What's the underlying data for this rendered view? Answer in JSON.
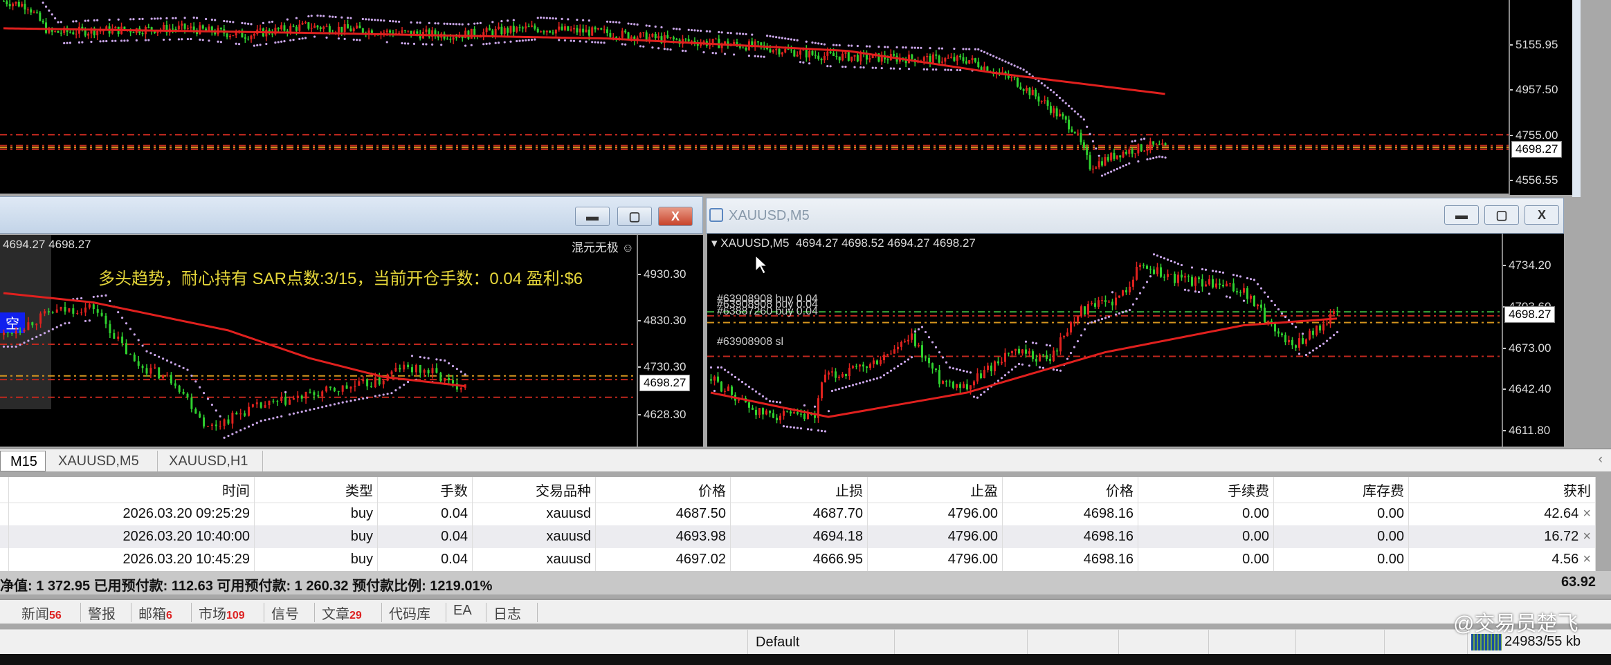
{
  "top_chart": {
    "axis": [
      "5155.95",
      "4957.50",
      "4755.00",
      "4556.55"
    ],
    "axis_prices": [
      5155.95,
      4957.5,
      4755.0,
      4556.55
    ],
    "price_min": 4500,
    "price_max": 5355,
    "current_price": "4698.27",
    "current": 4698.27,
    "path": [
      [
        0,
        5350
      ],
      [
        8,
        5330
      ],
      [
        15,
        5210
      ],
      [
        30,
        5220
      ],
      [
        60,
        5230
      ],
      [
        80,
        5200
      ],
      [
        100,
        5240
      ],
      [
        130,
        5210
      ],
      [
        150,
        5200
      ],
      [
        175,
        5230
      ],
      [
        200,
        5210
      ],
      [
        220,
        5180
      ],
      [
        250,
        5150
      ],
      [
        270,
        5110
      ],
      [
        290,
        5100
      ],
      [
        320,
        5090
      ],
      [
        335,
        5000
      ],
      [
        345,
        4900
      ],
      [
        355,
        4780
      ],
      [
        360,
        4620
      ],
      [
        370,
        4680
      ],
      [
        380,
        4710
      ],
      [
        385,
        4700
      ]
    ],
    "ma": [
      [
        0,
        5230
      ],
      [
        100,
        5210
      ],
      [
        200,
        5185
      ],
      [
        280,
        5130
      ],
      [
        330,
        5030
      ],
      [
        385,
        4940
      ]
    ],
    "lines": [
      {
        "price": 4760,
        "color": "#c0281e"
      },
      {
        "price": 4712,
        "color": "#c0281e"
      },
      {
        "price": 4704,
        "color": "#d4951e"
      },
      {
        "price": 4696,
        "color": "#c0281e"
      }
    ]
  },
  "left_window": {
    "ohlc": "4694.27 4698.27",
    "brand": "混元无极",
    "brand_icon": "smiley-icon",
    "signal_text": "多头趋势，耐心持有 SAR点数:3/15，当前开仓手数：0.04 盈利:$6",
    "badge": "空",
    "axis": [
      "4930.30",
      "4830.30",
      "4730.30",
      "4628.30"
    ],
    "axis_prices": [
      4930.3,
      4830.3,
      4730.3,
      4628.3
    ],
    "price_min": 4560,
    "price_max": 5015,
    "current_price": "4698.27",
    "current": 4698.27,
    "path": [
      [
        0,
        4800
      ],
      [
        12,
        4850
      ],
      [
        22,
        4860
      ],
      [
        32,
        4740
      ],
      [
        42,
        4700
      ],
      [
        50,
        4600
      ],
      [
        60,
        4640
      ],
      [
        80,
        4680
      ],
      [
        92,
        4700
      ],
      [
        97,
        4730
      ],
      [
        105,
        4720
      ],
      [
        110,
        4690
      ],
      [
        113,
        4698
      ]
    ],
    "ma": [
      [
        0,
        4890
      ],
      [
        22,
        4870
      ],
      [
        55,
        4810
      ],
      [
        75,
        4750
      ],
      [
        93,
        4710
      ],
      [
        113,
        4690
      ]
    ],
    "lines": [
      {
        "price": 4780,
        "color": "#c0281e"
      },
      {
        "price": 4712,
        "color": "#d4951e"
      },
      {
        "price": 4704,
        "color": "#c0281e"
      },
      {
        "price": 4666,
        "color": "#c0281e"
      }
    ]
  },
  "right_window": {
    "title": "XAUUSD,M5",
    "ohlc_label": "XAUUSD,M5  4694.27 4698.52 4694.27 4698.27",
    "axis": [
      "4734.20",
      "4703.60",
      "4673.00",
      "4642.40",
      "4611.80"
    ],
    "axis_prices": [
      4734.2,
      4703.6,
      4673.0,
      4642.4,
      4611.8
    ],
    "price_min": 4600,
    "price_max": 4758,
    "current_price": "4698.27",
    "current": 4698.27,
    "path": [
      [
        0,
        4650
      ],
      [
        14,
        4625
      ],
      [
        30,
        4620
      ],
      [
        32,
        4650
      ],
      [
        46,
        4660
      ],
      [
        58,
        4680
      ],
      [
        66,
        4650
      ],
      [
        74,
        4645
      ],
      [
        86,
        4670
      ],
      [
        98,
        4665
      ],
      [
        106,
        4700
      ],
      [
        118,
        4710
      ],
      [
        124,
        4735
      ],
      [
        134,
        4725
      ],
      [
        146,
        4720
      ],
      [
        154,
        4715
      ],
      [
        162,
        4690
      ],
      [
        168,
        4675
      ],
      [
        174,
        4685
      ],
      [
        181,
        4700
      ]
    ],
    "ma": [
      [
        0,
        4640
      ],
      [
        34,
        4622
      ],
      [
        74,
        4640
      ],
      [
        114,
        4670
      ],
      [
        154,
        4690
      ],
      [
        181,
        4695
      ]
    ],
    "lines": [
      {
        "price": 4700,
        "color": "#3aa93a"
      },
      {
        "price": 4697,
        "color": "#c0281e"
      },
      {
        "price": 4692,
        "color": "#d4951e"
      },
      {
        "price": 4666.95,
        "color": "#c0281e"
      }
    ],
    "order_labels": [
      "#63908908 buy 0.04",
      "#63887260 buy 0.04",
      "#63908908 sl"
    ]
  },
  "chart_tabs": [
    "M15",
    "XAUUSD,M5",
    "XAUUSD,H1"
  ],
  "trade_table": {
    "headers": [
      "时间",
      "类型",
      "手数",
      "交易品种",
      "价格",
      "止损",
      "止盈",
      "价格",
      "手续费",
      "库存费",
      "获利"
    ],
    "rows": [
      [
        "2026.03.20 09:25:29",
        "buy",
        "0.04",
        "xauusd",
        "4687.50",
        "4687.70",
        "4796.00",
        "4698.16",
        "0.00",
        "0.00",
        "42.64"
      ],
      [
        "2026.03.20 10:40:00",
        "buy",
        "0.04",
        "xauusd",
        "4693.98",
        "4694.18",
        "4796.00",
        "4698.16",
        "0.00",
        "0.00",
        "16.72"
      ],
      [
        "2026.03.20 10:45:29",
        "buy",
        "0.04",
        "xauusd",
        "4697.02",
        "4666.95",
        "4796.00",
        "4698.16",
        "0.00",
        "0.00",
        "4.56"
      ]
    ],
    "summary": "净值: 1 372.95  已用预付款: 112.63  可用预付款: 1 260.32  预付款比例: 1219.01%",
    "total_profit": "63.92"
  },
  "bottom_tabs": [
    {
      "label": "新闻",
      "count": "56"
    },
    {
      "label": "警报"
    },
    {
      "label": "邮箱",
      "count": "6"
    },
    {
      "label": "市场",
      "count": "109"
    },
    {
      "label": "信号"
    },
    {
      "label": "文章",
      "count": "29"
    },
    {
      "label": "代码库"
    },
    {
      "label": "EA"
    },
    {
      "label": "日志"
    }
  ],
  "status": {
    "profile": "Default",
    "traffic": "24983/55 kb",
    "watermark": "@交易员楚飞"
  }
}
